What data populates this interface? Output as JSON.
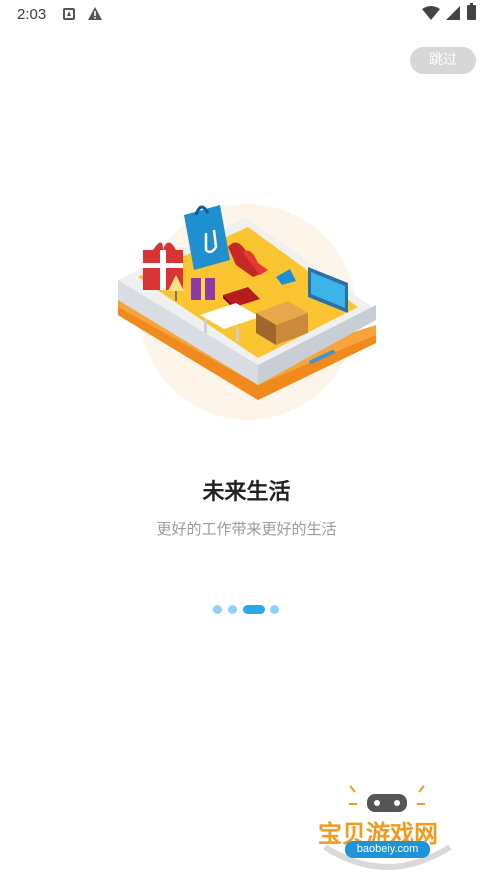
{
  "status_bar": {
    "time": "2:03"
  },
  "skip_button": {
    "label": "跳过"
  },
  "onboarding": {
    "title": "未来生活",
    "subtitle": "更好的工作带来更好的生活",
    "page_indicator": {
      "total": 4,
      "current": 3
    }
  },
  "watermark": {
    "text": "宝贝游戏网",
    "url": "baobeiy.com"
  },
  "colors": {
    "accent": "#29a9ec",
    "dot_inactive": "#8fd1f7",
    "skip_bg": "#d7d7d7",
    "title": "#222222",
    "subtitle": "#9a9a9a"
  }
}
